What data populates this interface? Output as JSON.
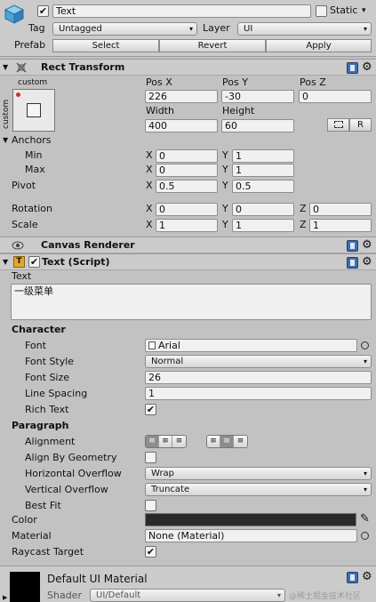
{
  "gameobject": {
    "name": "Text",
    "static_label": "Static",
    "tag_label": "Tag",
    "tag_value": "Untagged",
    "layer_label": "Layer",
    "layer_value": "UI",
    "prefab_label": "Prefab",
    "prefab_buttons": [
      "Select",
      "Revert",
      "Apply"
    ],
    "active": true
  },
  "rect_transform": {
    "title": "Rect Transform",
    "anchor_preset_top": "custom",
    "anchor_preset_side": "custom",
    "pos_x_label": "Pos X",
    "pos_y_label": "Pos Y",
    "pos_z_label": "Pos Z",
    "pos_x": "226",
    "pos_y": "-30",
    "pos_z": "0",
    "width_label": "Width",
    "height_label": "Height",
    "width": "400",
    "height": "60",
    "r_button": "R",
    "anchors_label": "Anchors",
    "min_label": "Min",
    "max_label": "Max",
    "min_x": "0",
    "min_y": "1",
    "max_x": "0",
    "max_y": "1",
    "pivot_label": "Pivot",
    "pivot_x": "0.5",
    "pivot_y": "0.5",
    "rotation_label": "Rotation",
    "rot_x": "0",
    "rot_y": "0",
    "rot_z": "0",
    "scale_label": "Scale",
    "scale_x": "1",
    "scale_y": "1",
    "scale_z": "1",
    "x": "X",
    "y": "Y",
    "z": "Z"
  },
  "canvas_renderer": {
    "title": "Canvas Renderer"
  },
  "text_script": {
    "title": "Text (Script)",
    "enabled": true,
    "text_label": "Text",
    "text_value": "一级菜单",
    "character_label": "Character",
    "font_label": "Font",
    "font_value": "Arial",
    "font_style_label": "Font Style",
    "font_style_value": "Normal",
    "font_size_label": "Font Size",
    "font_size_value": "26",
    "line_spacing_label": "Line Spacing",
    "line_spacing_value": "1",
    "rich_text_label": "Rich Text",
    "rich_text": true,
    "paragraph_label": "Paragraph",
    "alignment_label": "Alignment",
    "align_geometry_label": "Align By Geometry",
    "align_geometry": false,
    "h_overflow_label": "Horizontal Overflow",
    "h_overflow_value": "Wrap",
    "v_overflow_label": "Vertical Overflow",
    "v_overflow_value": "Truncate",
    "best_fit_label": "Best Fit",
    "best_fit": false,
    "color_label": "Color",
    "color_value": "#2a2a2a",
    "material_label": "Material",
    "material_value": "None (Material)",
    "raycast_label": "Raycast Target",
    "raycast": true
  },
  "material": {
    "name": "Default UI Material",
    "shader_label": "Shader",
    "shader_value": "UI/Default"
  },
  "watermark": "@稀土掘金技术社区",
  "icons": {
    "check": "✔",
    "dropdown": "▾",
    "fold_open": "▼",
    "fold_closed": "▶",
    "gear": "⚙",
    "dropper": "✎"
  }
}
